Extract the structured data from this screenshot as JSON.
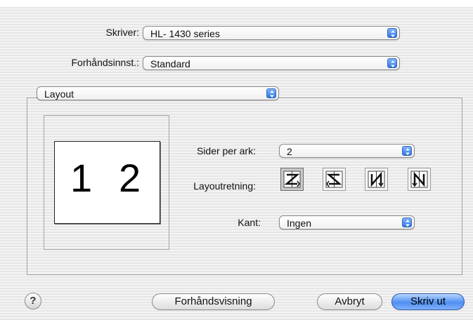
{
  "printer": {
    "label": "Skriver:",
    "value": "HL- 1430 series"
  },
  "presets": {
    "label": "Forhåndsinnst.:",
    "value": "Standard"
  },
  "panel": {
    "value": "Layout"
  },
  "preview": {
    "page_left": "1",
    "page_right": "2"
  },
  "layout": {
    "pages_per_sheet_label": "Sider per ark:",
    "pages_per_sheet_value": "2",
    "direction_label": "Layoutretning:",
    "directions": [
      {
        "icon": "layout-z-icon",
        "selected": true
      },
      {
        "icon": "layout-reverse-z-icon",
        "selected": false
      },
      {
        "icon": "layout-n-icon",
        "selected": false
      },
      {
        "icon": "layout-reverse-n-icon",
        "selected": false
      }
    ],
    "border_label": "Kant:",
    "border_value": "Ingen"
  },
  "buttons": {
    "help": "?",
    "preview": "Forhåndsvisning",
    "cancel": "Avbryt",
    "print": "Skriv ut"
  },
  "colors": {
    "accent": "#4f8ef0",
    "stepper": "#2f76e5"
  }
}
